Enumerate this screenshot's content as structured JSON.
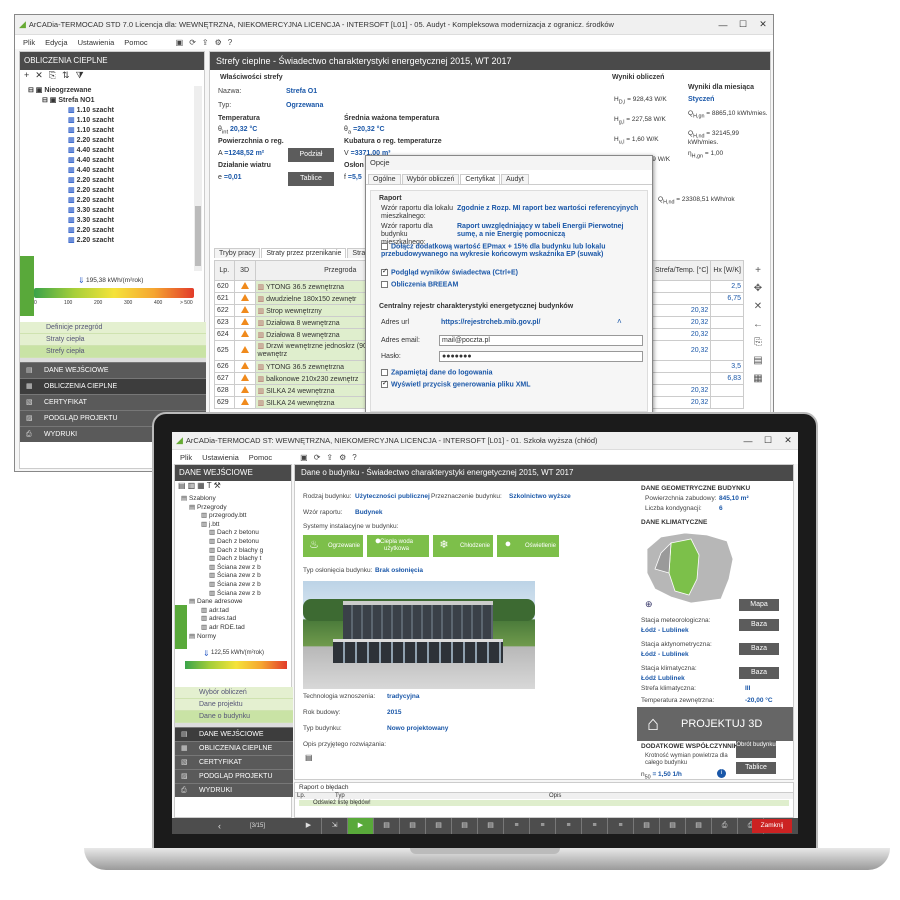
{
  "back": {
    "title": "ArCADia-TERMOCAD STD 7.0 Licencja dla: WEWNĘTRZNA, NIEKOMERCYJNA LICENCJA - INTERSOFT [L01] - 05. Audyt - Kompleksowa modernizacja z ogranicz. środków",
    "menu": [
      "Plik",
      "Edycja",
      "Ustawienia",
      "Pomoc"
    ],
    "side_title": "OBLICZENIA CIEPLNE",
    "main_title": "Strefy cieplne - Świadectwo charakterystyki energetycznej 2015, WT 2017",
    "tree": {
      "root": "Nieogrzewane",
      "zone": "Strefa NO1",
      "items": [
        "1.10 szacht",
        "1.10 szacht",
        "1.10 szacht",
        "2.20 szacht",
        "4.40 szacht",
        "4.40 szacht",
        "4.40 szacht",
        "2.20 szacht",
        "2.20 szacht",
        "2.20 szacht",
        "3.30 szacht",
        "3.30 szacht",
        "2.20 szacht",
        "2.20 szacht"
      ]
    },
    "energy_value": "195,38 kWh/(m²rok)",
    "energy_ticks": [
      "0",
      "100",
      "200",
      "300",
      "400",
      "> 500"
    ],
    "green_items": [
      "Definicje przegród",
      "Straty ciepła",
      "Strefy ciepła"
    ],
    "nav": [
      "DANE WEJŚCIOWE",
      "OBLICZENIA CIEPLNE",
      "CERTYFIKAT",
      "PODGLĄD PROJEKTU",
      "WYDRUKI"
    ],
    "props": {
      "header": "Właściwości strefy",
      "nazwa_lbl": "Nazwa:",
      "nazwa": "Strefa O1",
      "typ_lbl": "Typ:",
      "typ": "Ogrzewana",
      "temp_lbl": "Temperatura",
      "temp_sym": "θ",
      "temp_sub": "int",
      "temp": "20,32 °C",
      "sr_lbl": "Średnia ważona temperatura",
      "sr_sym": "θ",
      "sr_sub": "a",
      "sr": "=20,32 °C",
      "pow_lbl": "Powierzchnia o reg.",
      "pow_sym": "A",
      "pow": "=1248,52 m²",
      "kub_lbl": "Kubatura o reg. temperaturze",
      "kub_sym": "V",
      "kub": "=3371,00 m³",
      "wiatr_lbl": "Działanie wiatru",
      "wiatr_sym": "e",
      "wiatr": "=0,01",
      "oslon_lbl": "Osłon",
      "f_sym": "f",
      "f_val": "=5,5",
      "btn_podzial": "Podział",
      "btn_tablice": "Tablice"
    },
    "results": {
      "header": "Wyniki obliczeń",
      "month_header": "Wyniki dla miesiąca",
      "month": "Styczeń",
      "rows": [
        [
          "H",
          "D,l",
          "= 928,43",
          "W/K"
        ],
        [
          "H",
          "g,l",
          "= 227,58",
          "W/K"
        ],
        [
          "H",
          "u,l",
          "= 1,60",
          "W/K"
        ],
        [
          "H",
          "A,l",
          "= 1457,59",
          "W/K"
        ]
      ],
      "mrows": [
        [
          "Q",
          "H,gn",
          "= 8865,10",
          "kWh/mies."
        ],
        [
          "Q",
          "H,nd",
          "= 32145,99",
          "kWh/mies."
        ],
        [
          "η",
          "H,gn",
          "= 1,00",
          ""
        ]
      ],
      "qh": [
        "Q",
        "H,nd",
        "= 23308,51",
        "kWh/rok"
      ]
    },
    "tabs": [
      "Tryby pracy",
      "Straty przez przenikanie",
      "Straty przez"
    ],
    "cols": {
      "lp": "Lp.",
      "d3": "3D",
      "przegroda": "Przegroda",
      "strefa": "Strefa/Temp. [°C]",
      "hx": "Hx [W/K]"
    },
    "rows": [
      {
        "lp": "620",
        "name": "YTONG 36.5 zewnętrzna",
        "t": "",
        "hx": "2,5"
      },
      {
        "lp": "621",
        "name": "dwudzielne 180x150 zewnętr",
        "t": "",
        "hx": "6,75"
      },
      {
        "lp": "622",
        "name": "Strop wewnętrzny",
        "t": "20,32",
        "hx": ""
      },
      {
        "lp": "623",
        "name": "Działowa 8 wewnętrzna",
        "t": "20,32",
        "hx": ""
      },
      {
        "lp": "624",
        "name": "Działowa 8 wewnętrzna",
        "t": "20,32",
        "hx": ""
      },
      {
        "lp": "625",
        "name": "Drzwi wewnętrzne jednoskrz (90cm x 200cm) wewnętrz",
        "t": "20,32",
        "hx": ""
      },
      {
        "lp": "626",
        "name": "YTONG 36.5 zewnętrzna",
        "t": "",
        "hx": "3,5"
      },
      {
        "lp": "627",
        "name": "balkonowe 210x230 zewnętrz",
        "t": "",
        "hx": "6,83"
      },
      {
        "lp": "628",
        "name": "SILKA 24 wewnętrzna",
        "t": "20,32",
        "hx": ""
      },
      {
        "lp": "629",
        "name": "SILKA 24 wewnętrzna",
        "t": "20,32",
        "hx": ""
      }
    ]
  },
  "dialog": {
    "title": "Opcje",
    "tabs": [
      "Ogólne",
      "Wybór obliczeń",
      "Certyfikat",
      "Audyt"
    ],
    "raport": "Raport",
    "lok_lbl": "Wzór raportu dla lokalu mieszkalnego:",
    "lok": "Zgodnie z Rozp. MI raport bez wartości referencyjnych",
    "bud_lbl": "Wzór raportu dla budynku mieszkalnego:",
    "bud": "Raport uwzględniający w tabeli Energii Pierwotnej sumę, a nie Energię pomocniczą",
    "chk1": "Dołącz dodatkową wartość EPmax + 15% dla budynku lub lokalu przebudowywanego na wykresie końcowym wskaźnika EP (suwak)",
    "chk2": "Podgląd wyników świadectwa (Ctrl+E)",
    "chk3": "Obliczenia BREEAM",
    "central": "Centralny rejestr charakterystyki energetycznej budynków",
    "url_lbl": "Adres url",
    "url": "https://rejestrcheb.mib.gov.pl/",
    "mail_lbl": "Adres email:",
    "mail": "mail@poczta.pl",
    "pass_lbl": "Hasło:",
    "pass": "●●●●●●●",
    "chk4": "Zapamiętaj dane do logowania",
    "chk5": "Wyświetl przycisk generowania pliku XML"
  },
  "front": {
    "title": "ArCADia-TERMOCAD ST: WEWNĘTRZNA, NIEKOMERCYJNA LICENCJA - INTERSOFT [L01] - 01. Szkoła wyższa (chłód)",
    "menu": [
      "Plik",
      "Ustawienia",
      "Pomoc"
    ],
    "side_title": "DANE WEJŚCIOWE",
    "main_title": "Dane o budynku - Świadectwo charakterystyki energetycznej 2015, WT 2017",
    "tree": [
      "Szablony",
      "Przegrody",
      "przegrody.btt",
      "j.btt",
      "Dach z betonu",
      "Dach z betonu",
      "Dach z blachy g",
      "Dach z blachy t",
      "Ściana zew z b",
      "Ściana zew z b",
      "Ściana zew z b",
      "Ściana zew z b",
      "Dane adresowe",
      "adr.tad",
      "adres.tad",
      "adr RDE.tad",
      "Normy"
    ],
    "energy_value": "122,55 kWh/(m²rok)",
    "green_items": [
      "Wybór obliczeń",
      "Dane projektu",
      "Dane o budynku"
    ],
    "nav": [
      "DANE WEJŚCIOWE",
      "OBLICZENIA CIEPLNE",
      "CERTYFIKAT",
      "PODGLĄD PROJEKTU",
      "WYDRUKI"
    ],
    "rodzaj_lbl": "Rodzaj budynku:",
    "rodzaj": "Użyteczności publicznej",
    "przezn_lbl": "Przeznaczenie budynku:",
    "przezn": "Szkolnictwo wyższe",
    "wzor_lbl": "Wzór raportu:",
    "wzor": "Budynek",
    "sys_lbl": "Systemy instalacyjne w budynku:",
    "systems": [
      "Ogrzewanie",
      "Ciepła woda użytkowa",
      "Chłodzenie",
      "Oświetlenie"
    ],
    "oslona_lbl": "Typ osłonięcia budynku:",
    "oslona": "Brak osłonięcia",
    "tech_lbl": "Technologia wznoszenia:",
    "tech": "tradycyjna",
    "rok_lbl": "Rok budowy:",
    "rok": "2015",
    "typb_lbl": "Typ budynku:",
    "typb": "Nowo projektowany",
    "opis_lbl": "Opis przyjętego rozwiązania:",
    "geo_h": "DANE GEOMETRYCZNE BUDYNKU",
    "pz_lbl": "Powierzchnia zabudowy:",
    "pz": "845,10 m²",
    "lk_lbl": "Liczba kondygnacji:",
    "lk": "6",
    "klim_h": "DANE KLIMATYCZNE",
    "mapa": "Mapa",
    "baza": "Baza",
    "st_met_lbl": "Stacja meteorologiczna:",
    "st_met": "Łódź - Lublinek",
    "st_akt_lbl": "Stacja aktynometryczna:",
    "st_akt": "Łódź - Lublinek",
    "st_kl_lbl": "Stacja klimatyczna:",
    "st_kl": "Łódź Lublinek",
    "strefa_lbl": "Strefa klimatyczna:",
    "strefa": "III",
    "tz_lbl": "Temperatura zewnętrzna:",
    "tz": "-20,00 °C",
    "proj3d": "PROJEKTUJ 3D",
    "dod_h": "DODATKOWE WSPÓŁCZYNNIKI",
    "krot_lbl": "Krotność wymian powietrza dla całego budynku",
    "krot_sym": "n",
    "krot_sub": "50",
    "krot": "= 1,50 1/h",
    "obrot": "Obrót budynku",
    "tablice": "Tablice",
    "err_title": "Raport o błędach",
    "err_cols": [
      "Lp.",
      "Typ",
      "Opis"
    ],
    "err_msg": "Odśwież listę błędów!",
    "page": "[3/15]",
    "exit": "Zamknij"
  }
}
